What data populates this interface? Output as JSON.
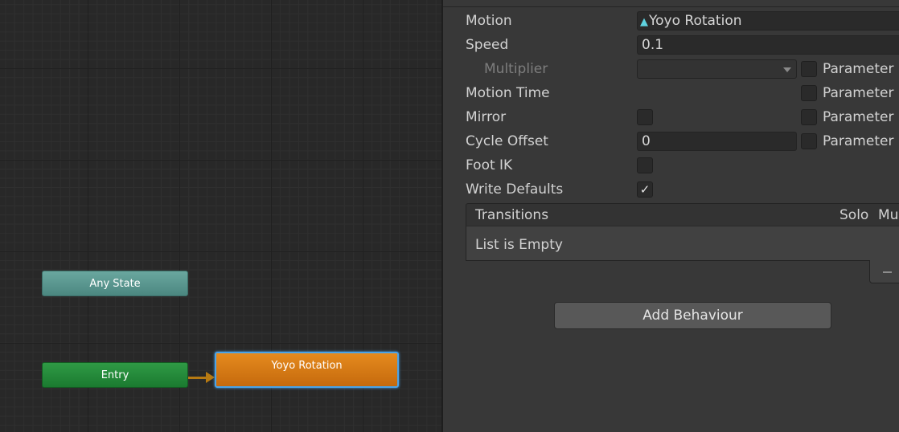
{
  "graph": {
    "any_state": "Any State",
    "entry": "Entry",
    "selected_state": "Yoyo Rotation"
  },
  "inspector": {
    "motion": {
      "label": "Motion",
      "value": "Yoyo Rotation",
      "icon": "animation-clip-icon"
    },
    "speed": {
      "label": "Speed",
      "value": "0.1"
    },
    "multiplier": {
      "label": "Multiplier",
      "value": "",
      "parameter_label": "Parameter",
      "parameter_checked": false
    },
    "motion_time": {
      "label": "Motion Time",
      "parameter_label": "Parameter",
      "parameter_checked": false
    },
    "mirror": {
      "label": "Mirror",
      "checked": false,
      "parameter_label": "Parameter",
      "parameter_checked": false
    },
    "cycle_offset": {
      "label": "Cycle Offset",
      "value": "0",
      "parameter_label": "Parameter",
      "parameter_checked": false
    },
    "foot_ik": {
      "label": "Foot IK",
      "checked": false
    },
    "write_defaults": {
      "label": "Write Defaults",
      "checked": true,
      "check_glyph": "✓"
    },
    "transitions": {
      "title": "Transitions",
      "solo": "Solo",
      "mute": "Mu",
      "empty_text": "List is Empty"
    },
    "add_behaviour": "Add Behaviour"
  },
  "colors": {
    "selected_state": "#c56a0d",
    "any_state": "#4b8780",
    "entry": "#1b7a30",
    "selection_outline": "#4aa3e8"
  }
}
